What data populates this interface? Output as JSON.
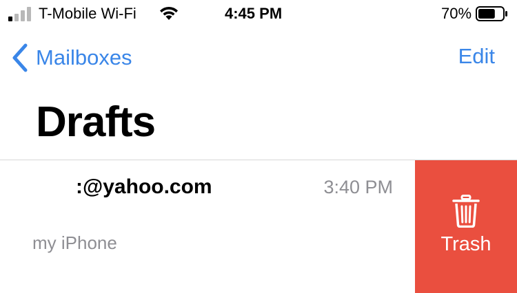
{
  "status_bar": {
    "carrier": "T-Mobile Wi-Fi",
    "time": "4:45 PM",
    "battery_percent": "70%",
    "battery_level": 0.7,
    "signal_bars_active": 1,
    "signal_bars_total": 4,
    "icons": [
      "signal-icon",
      "wifi-icon",
      "battery-icon"
    ]
  },
  "nav": {
    "back_label": "Mailboxes",
    "edit_label": "Edit",
    "accent_color": "#3a86e8"
  },
  "page": {
    "title": "Drafts"
  },
  "messages": [
    {
      "sender": ":@yahoo.com",
      "time": "3:40 PM",
      "preview": "my iPhone"
    }
  ],
  "swipe_action": {
    "label": "Trash",
    "icon": "trash-icon",
    "color": "#ea4f3f"
  }
}
